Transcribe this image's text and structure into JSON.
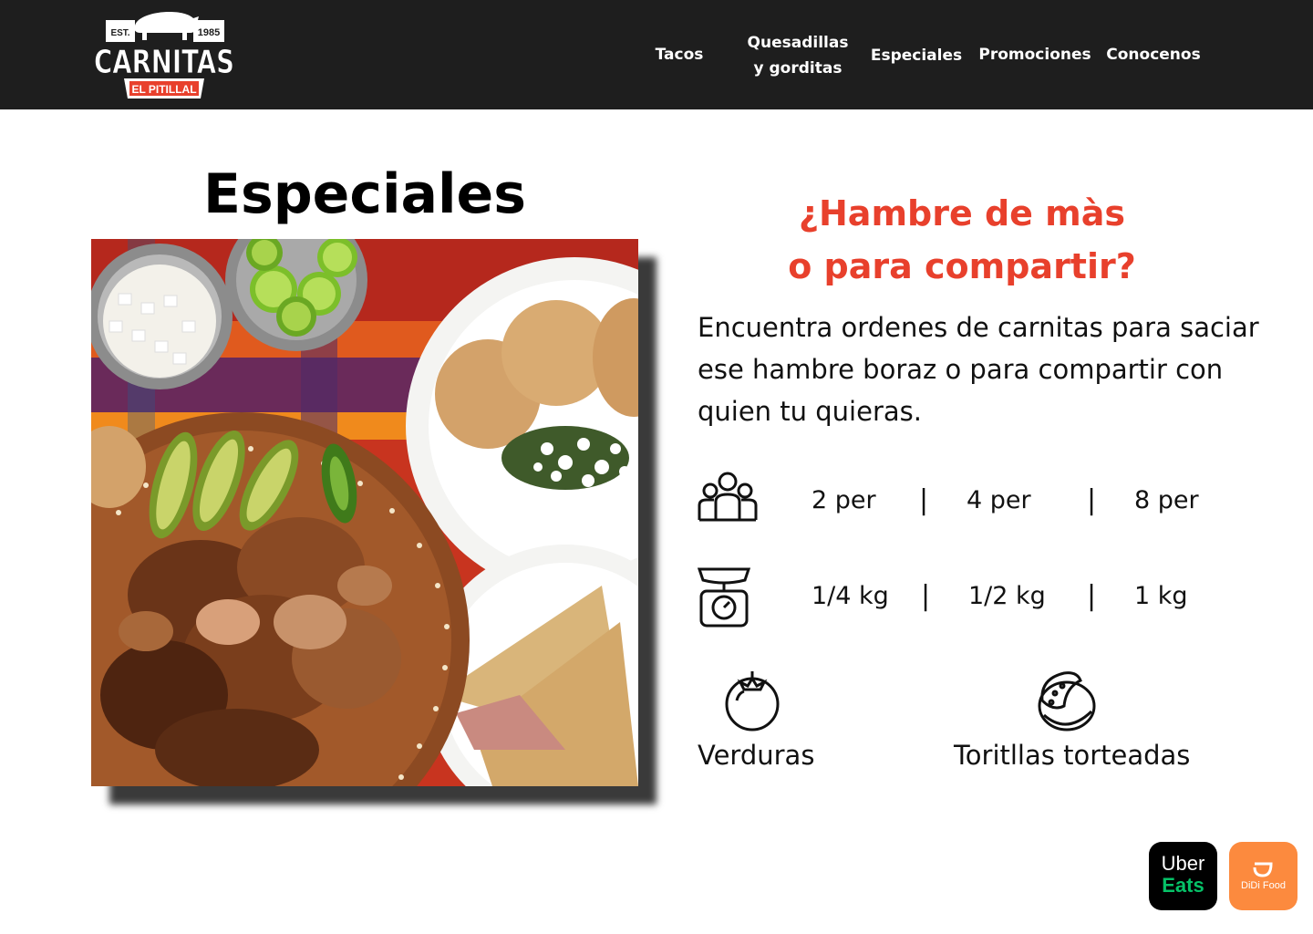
{
  "brand": {
    "est_label": "EST.",
    "year": "1985",
    "name": "CARNITAS",
    "tagline": "EL PITILLAL"
  },
  "nav": {
    "tacos": "Tacos",
    "quesadillas_line1": "Quesadillas",
    "quesadillas_line2": "y gorditas",
    "especiales": "Especiales",
    "promociones": "Promociones",
    "conocenos": "Conocenos"
  },
  "section": {
    "title": "Especiales"
  },
  "promo": {
    "headline_line1": "¿Hambre de màs",
    "headline_line2": "o para compartir?",
    "description": "Encuentra ordenes de carnitas para saciar ese hambre boraz o para compartir con quien tu quieras."
  },
  "portions": {
    "icon": "people-icon",
    "options": [
      "2 per",
      "4 per",
      "8 per"
    ],
    "separator": "|"
  },
  "weights": {
    "icon": "scale-icon",
    "options": [
      "1/4 kg",
      "1/2  kg",
      "1 kg"
    ],
    "separator": "|"
  },
  "features": [
    {
      "icon": "tomato-icon",
      "label": "Verduras"
    },
    {
      "icon": "tortillas-icon",
      "label": "Toritllas torteadas"
    }
  ],
  "delivery": {
    "uber_line1": "Uber",
    "uber_line2": "Eats",
    "didi": "DiDi Food"
  },
  "colors": {
    "header_bg": "#1e1e1e",
    "accent_red": "#e8402c",
    "uber_green": "#06c167",
    "didi_orange": "#fc8a3e"
  }
}
